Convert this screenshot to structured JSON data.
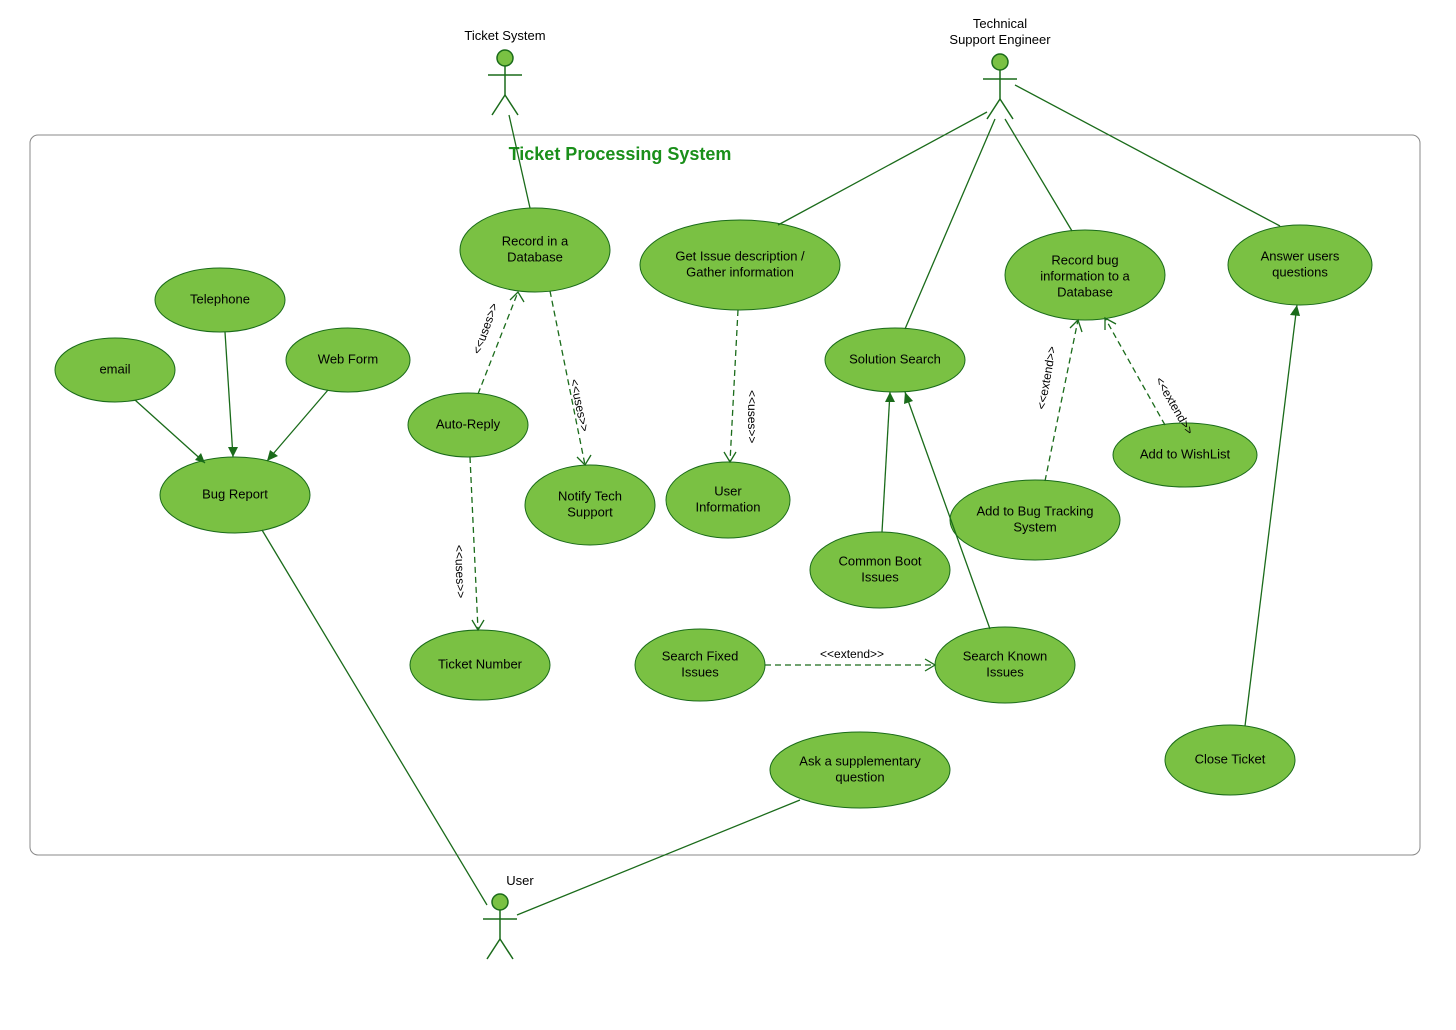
{
  "title": "Ticket Processing System",
  "actors": {
    "ticket_system": "Ticket System",
    "tech_engineer_line1": "Technical",
    "tech_engineer_line2": "Support Engineer",
    "user": "User"
  },
  "usecases": {
    "email": "email",
    "telephone": "Telephone",
    "webform": "Web Form",
    "bugreport": "Bug Report",
    "record_db_l1": "Record in a",
    "record_db_l2": "Database",
    "autoreply": "Auto-Reply",
    "notify_l1": "Notify Tech",
    "notify_l2": "Support",
    "ticketnum": "Ticket Number",
    "getissue_l1": "Get Issue description /",
    "getissue_l2": "Gather information",
    "userinfo_l1": "User",
    "userinfo_l2": "Information",
    "solutionsearch": "Solution Search",
    "commonboot_l1": "Common Boot",
    "commonboot_l2": "Issues",
    "searchfixed_l1": "Search Fixed",
    "searchfixed_l2": "Issues",
    "searchknown_l1": "Search Known",
    "searchknown_l2": "Issues",
    "recordbug_l1": "Record bug",
    "recordbug_l2": "information to a",
    "recordbug_l3": "Database",
    "addbugtrack_l1": "Add to Bug Tracking",
    "addbugtrack_l2": "System",
    "addwishlist": "Add to WishList",
    "answerusers_l1": "Answer users",
    "answerusers_l2": "questions",
    "closeticket": "Close Ticket",
    "asksupp_l1": "Ask a supplementary",
    "asksupp_l2": "question"
  },
  "stereotypes": {
    "uses": "<<uses>>",
    "extend": "<<extend>>"
  }
}
